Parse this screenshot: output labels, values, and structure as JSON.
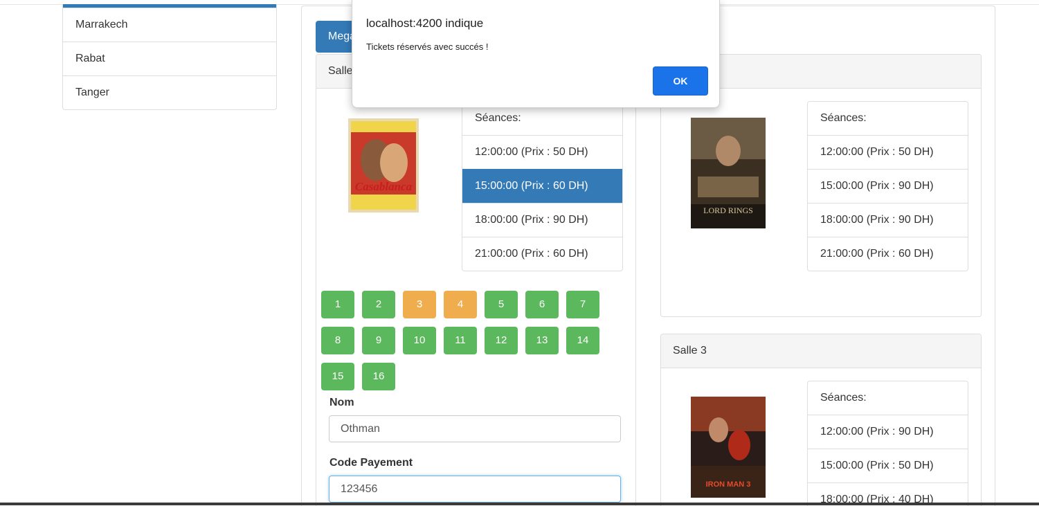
{
  "cities": [
    "Marrakech",
    "Rabat",
    "Tanger"
  ],
  "cinema_tab": "Mega",
  "dialog": {
    "title": "localhost:4200 indique",
    "message": "Tickets réservés avec succés !",
    "ok_label": "OK"
  },
  "salle1": {
    "title": "Salle",
    "seances_label": "Séances:",
    "seances": [
      "12:00:00 (Prix : 50 DH)",
      "15:00:00 (Prix : 60 DH)",
      "18:00:00 (Prix : 90 DH)",
      "21:00:00 (Prix : 60 DH)"
    ],
    "selected_seance": "15:00:00 (Prix : 60 DH)",
    "poster": "casablanca-poster",
    "poster_text": "Casablanca",
    "seats": [
      "1",
      "2",
      "3",
      "4",
      "5",
      "6",
      "7",
      "8",
      "9",
      "10",
      "11",
      "12",
      "13",
      "14",
      "15",
      "16"
    ],
    "taken_seats": [
      "3",
      "4"
    ]
  },
  "salle2": {
    "seances_label": "Séances:",
    "seances": [
      "12:00:00 (Prix : 50 DH)",
      "15:00:00 (Prix : 90 DH)",
      "18:00:00 (Prix : 90 DH)",
      "21:00:00 (Prix : 60 DH)"
    ],
    "poster": "lord-of-the-rings-poster",
    "poster_text": "LORD RINGS"
  },
  "salle3": {
    "title": "Salle 3",
    "seances_label": "Séances:",
    "seances": [
      "12:00:00 (Prix : 90 DH)",
      "15:00:00 (Prix : 50 DH)",
      "18:00:00 (Prix : 40 DH)"
    ],
    "poster": "iron-man-3-poster",
    "poster_text": "IRON MAN 3"
  },
  "form": {
    "nom_label": "Nom",
    "nom_value": "Othman",
    "code_label": "Code Payement",
    "code_value": "123456"
  },
  "colors": {
    "primary": "#337ab7",
    "seat_free": "#5cb85c",
    "seat_taken": "#f0ad4e",
    "dialog_button": "#1a73e8"
  }
}
